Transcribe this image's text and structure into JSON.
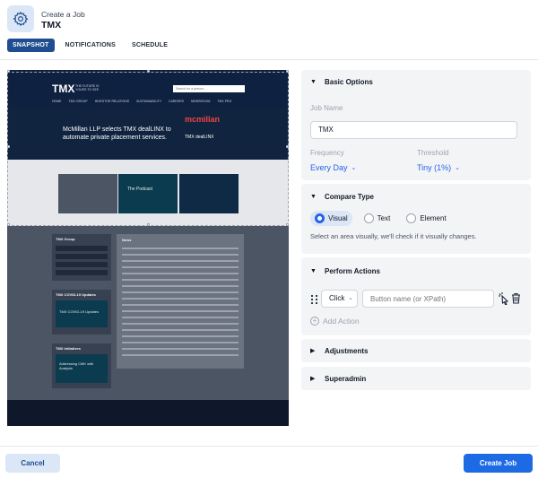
{
  "header": {
    "subtitle": "Create a Job",
    "title": "TMX",
    "icon": "gear-icon"
  },
  "tabs": [
    {
      "label": "SNAPSHOT",
      "active": true
    },
    {
      "label": "NOTIFICATIONS",
      "active": false
    },
    {
      "label": "SCHEDULE",
      "active": false
    }
  ],
  "preview": {
    "logo": "TMX",
    "logo_sub": "THE FUTURE IS YOURS TO SEE",
    "search_placeholder": "Search for a person...",
    "nav": [
      "HOME",
      "TMX GROUP",
      "INVESTOR RELATIONS",
      "SUSTAINABILITY",
      "CAREERS",
      "NEWSROOM",
      "TMX PRO"
    ],
    "hero_text": "McMillan LLP selects TMX dealLINX to automate private placement services.",
    "hero_brand": "mcmillan",
    "hero_product": "TMX dealLINX",
    "podcast": "The Podcast",
    "side_title": "TMX Group",
    "news_title": "News",
    "covid_title": "TMX COVID-19 Updates",
    "covid_img": "TMX COVID-19 Updates",
    "initiatives_title": "TMX Initiatives",
    "initiatives_img": "Addressing CMK with Analysis"
  },
  "basic_options": {
    "title": "Basic Options",
    "job_name_label": "Job Name",
    "job_name_value": "TMX",
    "frequency_label": "Frequency",
    "frequency_value": "Every Day",
    "threshold_label": "Threshold",
    "threshold_value": "Tiny (1%)"
  },
  "compare_type": {
    "title": "Compare Type",
    "options": [
      "Visual",
      "Text",
      "Element"
    ],
    "selected": "Visual",
    "hint": "Select an area visually, we'll check if it visually changes."
  },
  "perform_actions": {
    "title": "Perform Actions",
    "action_type": "Click",
    "button_placeholder": "Button name (or XPath)",
    "add_action_label": "Add Action"
  },
  "adjustments": {
    "title": "Adjustments"
  },
  "superadmin": {
    "title": "Superadmin"
  },
  "footer": {
    "cancel_label": "Cancel",
    "create_label": "Create Job"
  },
  "colors": {
    "primary": "#1d6ae5",
    "tab_active": "#1e4d91",
    "accent_blue": "#2563eb",
    "panel_bg": "#f3f4f6"
  }
}
